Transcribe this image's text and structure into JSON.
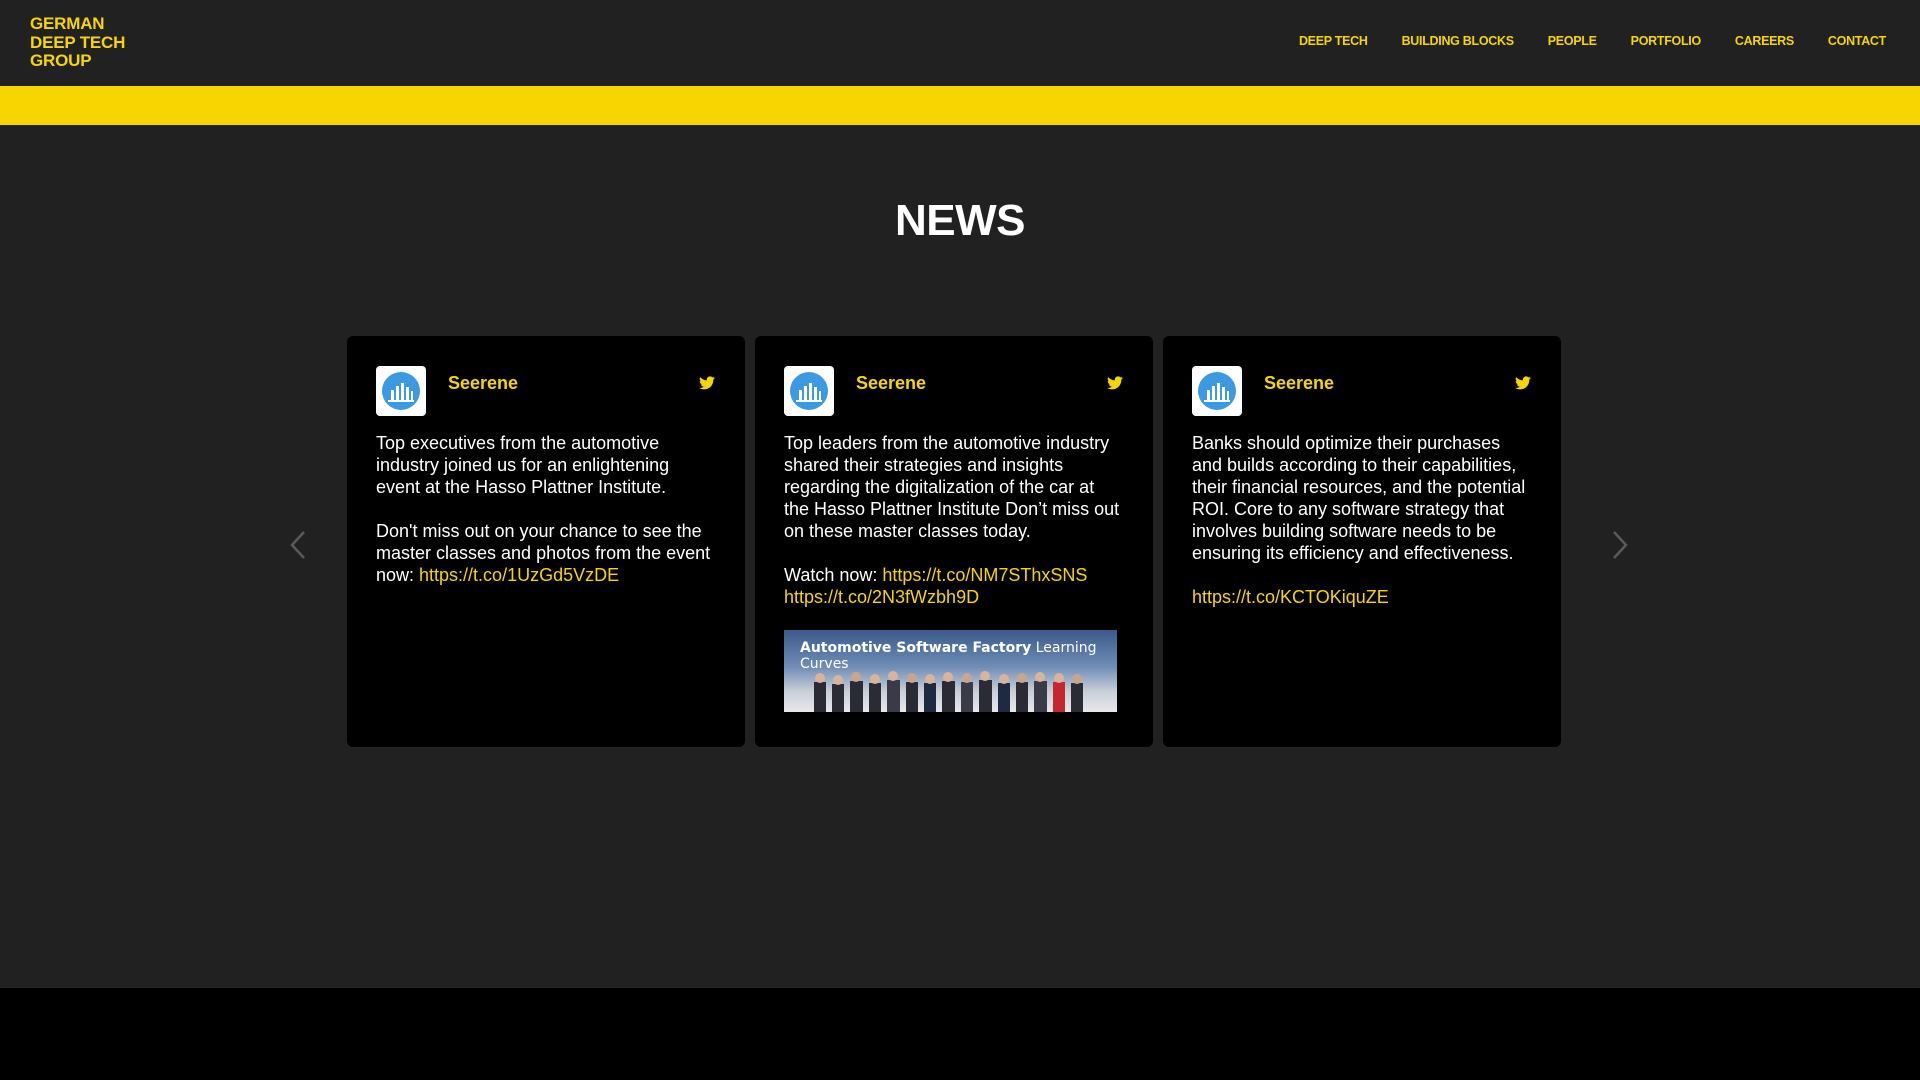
{
  "header": {
    "logo_lines": [
      "GERMAN",
      "DEEP TECH",
      "GROUP"
    ],
    "nav": [
      "DEEP TECH",
      "BUILDING BLOCKS",
      "PEOPLE",
      "PORTFOLIO",
      "CAREERS",
      "CONTACT"
    ]
  },
  "progress": {
    "fraction": 0.2
  },
  "news": {
    "title": "NEWS",
    "cards": [
      {
        "author": "Seerene",
        "paragraphs": [
          "Top executives from the automotive industry joined us for an enlightening event at the Hasso Plattner Institute."
        ],
        "p2_text": "Don't miss out on your chance to see the master classes and photos from the event now: ",
        "p2_link": "https://t.co/1UzGd5VzDE"
      },
      {
        "author": "Seerene",
        "text": "Top leaders from the automotive industry shared their strategies and insights regarding the digitalization of the car at the Hasso Plattner Institute Don’t miss out on these master classes today.",
        "watch_label": "Watch now: ",
        "link1": "https://t.co/NM7SThxSNS",
        "link2": "https://t.co/2N3fWzbh9D",
        "media_title_bold": "Automotive Software Factory",
        "media_title_rest": " Learning Curves"
      },
      {
        "author": "Seerene",
        "text": "Banks should optimize their purchases and builds according to their capabilities, their financial resources, and the potential ROI. Core to any software strategy that involves building software needs to be ensuring its efficiency and effectiveness.",
        "link": "https://t.co/KCTOKiquZE"
      }
    ]
  },
  "colors": {
    "accent": "#f7d600",
    "background": "#212121",
    "card": "#000000"
  },
  "icons": [
    "chevron-left-icon",
    "chevron-right-icon",
    "twitter-icon",
    "seerene-logo-icon"
  ]
}
